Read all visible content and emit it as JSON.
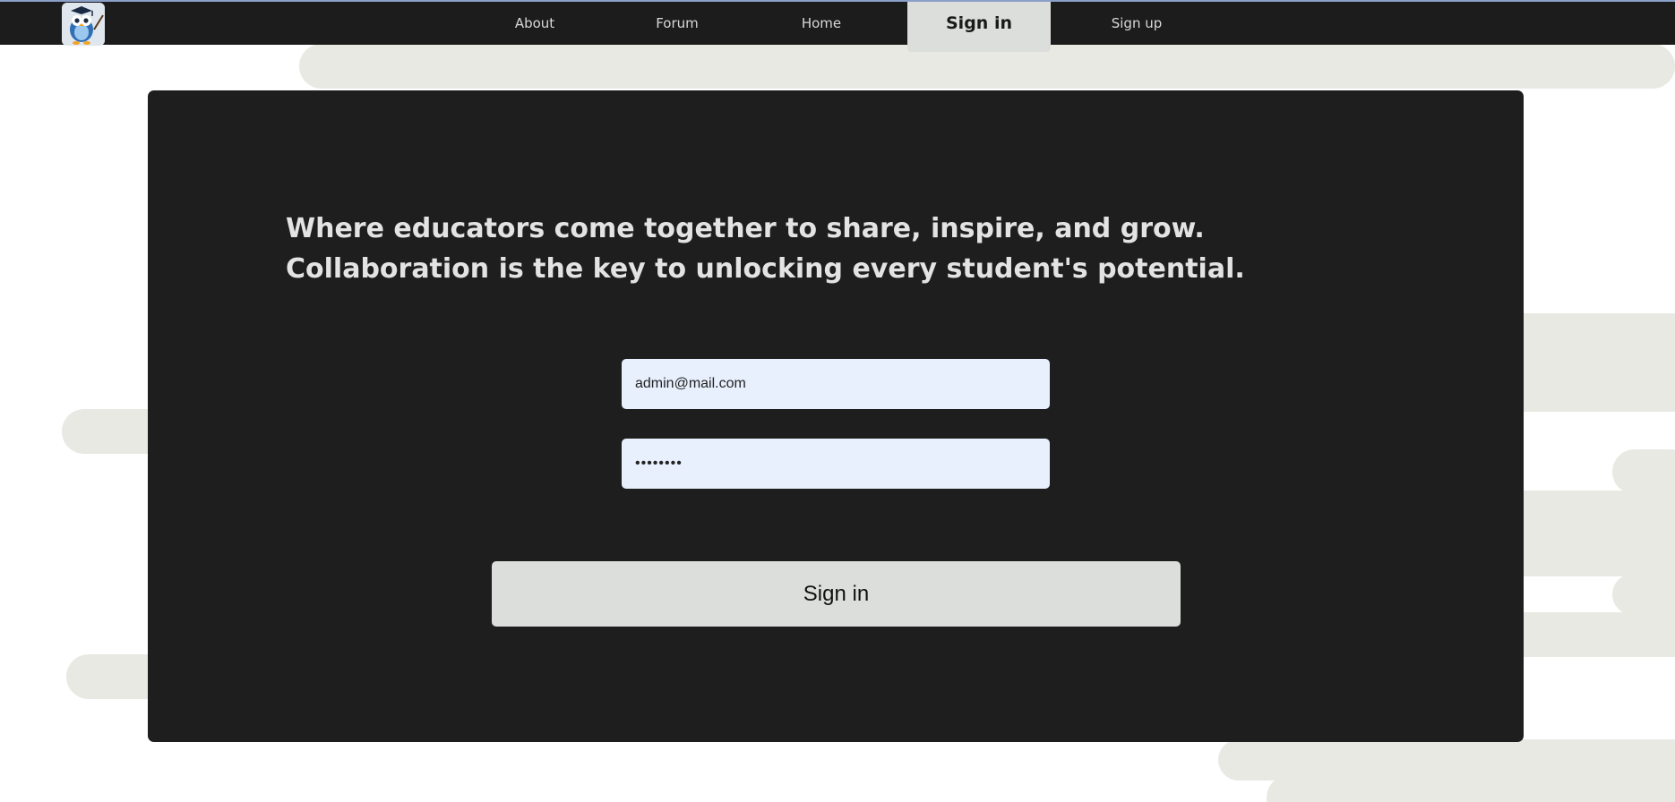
{
  "nav": {
    "logo_icon": "owl-teacher-icon",
    "items": [
      {
        "label": "About",
        "active": false
      },
      {
        "label": "Forum",
        "active": false
      },
      {
        "label": "Home",
        "active": false
      },
      {
        "label": "Sign in",
        "active": true
      },
      {
        "label": "Sign up",
        "active": false
      }
    ]
  },
  "main": {
    "headline": "Where educators come together to share, inspire, and grow. Collaboration is the key to unlocking every student's potential."
  },
  "form": {
    "email_value": "admin@mail.com",
    "password_value": "••••••••",
    "submit_label": "Sign in"
  },
  "colors": {
    "nav_background": "#1c1c1c",
    "card_background": "#1e1e1e",
    "stripe": "#e9e9e3",
    "input_background": "#e8effd",
    "button_background": "#dcdedb"
  }
}
